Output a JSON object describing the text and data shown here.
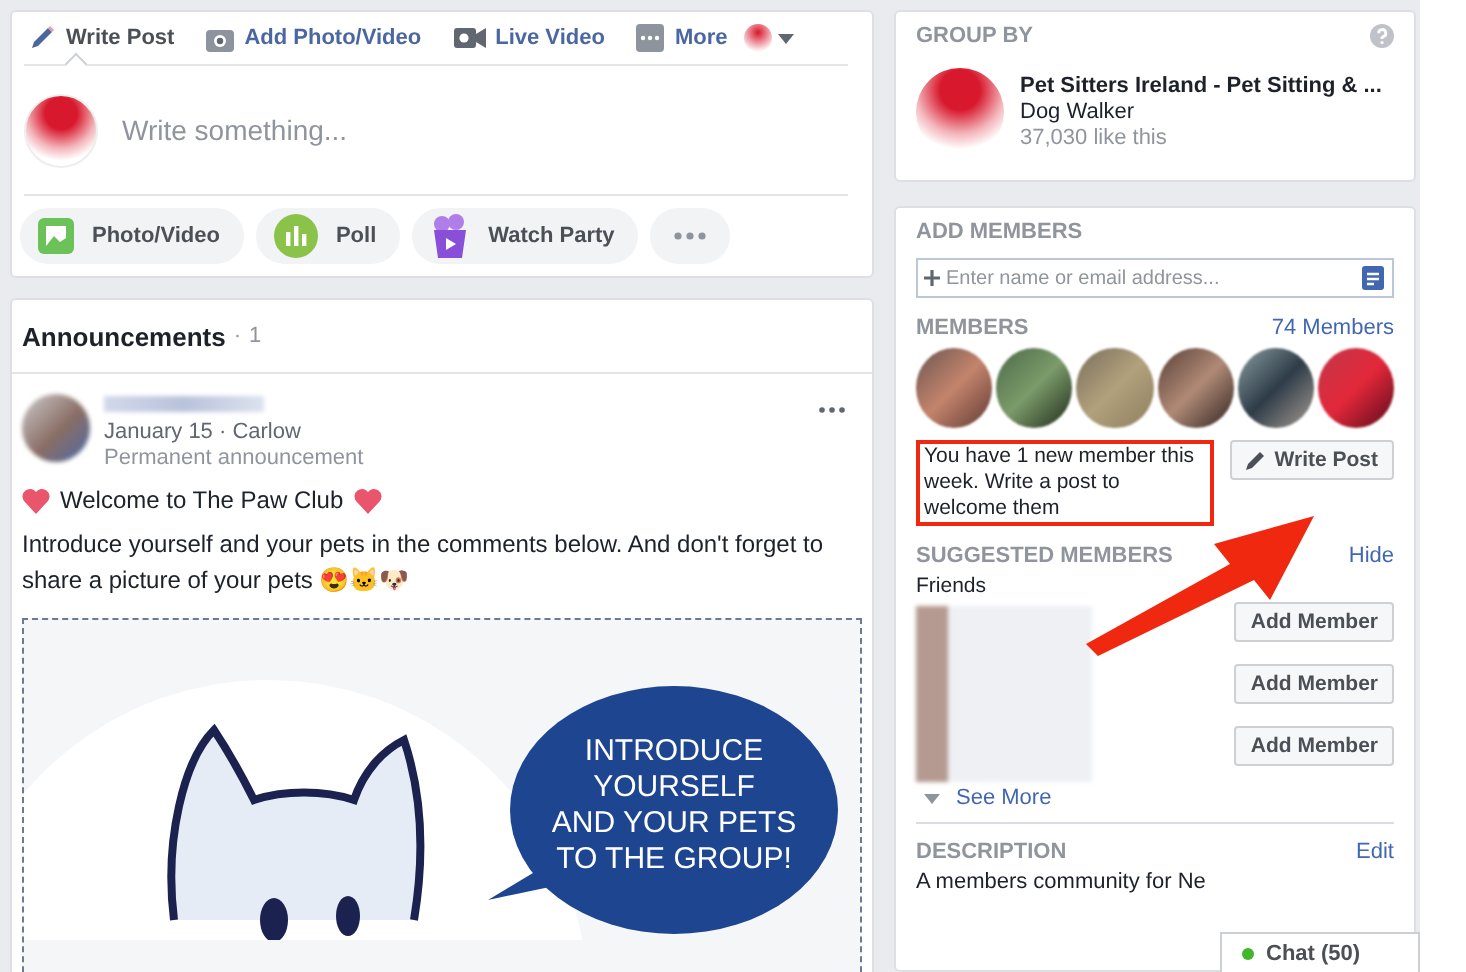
{
  "composer": {
    "tabs": [
      {
        "label": "Write Post",
        "kind": "pencil",
        "selected": true
      },
      {
        "label": "Add Photo/Video",
        "kind": "camera",
        "selected": false
      },
      {
        "label": "Live Video",
        "kind": "video",
        "selected": false
      },
      {
        "label": "More",
        "kind": "more",
        "selected": false
      }
    ],
    "placeholder": "Write something...",
    "actions": [
      {
        "label": "Photo/Video",
        "kind": "photo"
      },
      {
        "label": "Poll",
        "kind": "poll"
      },
      {
        "label": "Watch Party",
        "kind": "party"
      }
    ]
  },
  "announcements": {
    "title": "Announcements",
    "separator": "·",
    "count": "1",
    "post": {
      "date": "January 15 · Carlow",
      "badge": "Permanent announcement",
      "headline": "Welcome to The Paw Club",
      "body": "Introduce yourself and your pets in the comments below. And don't forget to share a picture of your pets 😍🐱🐶",
      "image_text": [
        "INTRODUCE",
        "YOURSELF",
        "AND YOUR PETS",
        "TO THE GROUP!"
      ]
    }
  },
  "group_by": {
    "heading": "GROUP BY",
    "page_name": "Pet Sitters Ireland - Pet Sitting & ...",
    "category": "Dog Walker",
    "likes": "37,030 like this"
  },
  "add_members": {
    "heading": "ADD MEMBERS",
    "placeholder": "Enter name or email address...",
    "members_heading": "MEMBERS",
    "members_link": "74 Members",
    "notice": "You have 1 new member this week. Write a post to welcome them",
    "write_post": "Write Post",
    "suggested_heading": "SUGGESTED MEMBERS",
    "hide": "Hide",
    "friends": "Friends",
    "suggestions": [
      {
        "button": "Add Member"
      },
      {
        "button": "Add Member"
      },
      {
        "button": "Add Member"
      }
    ],
    "see_more": "See More"
  },
  "description": {
    "heading": "DESCRIPTION",
    "edit": "Edit",
    "text": "A members community for Ne"
  },
  "chat": {
    "label": "Chat (50)",
    "online": true
  }
}
